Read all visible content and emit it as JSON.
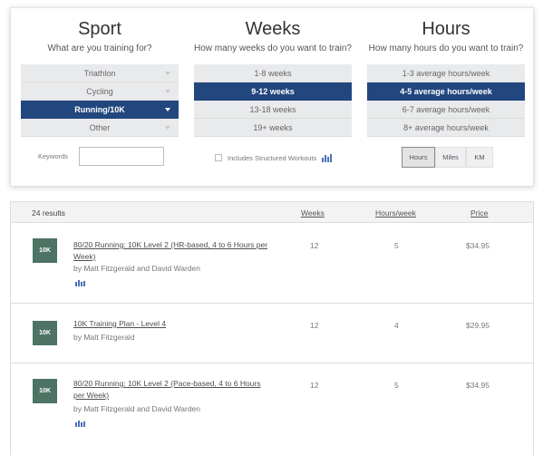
{
  "filters": {
    "sport": {
      "title": "Sport",
      "subtitle": "What are you training for?",
      "options": [
        {
          "label": "Triathlon",
          "selected": false
        },
        {
          "label": "Cycling",
          "selected": false
        },
        {
          "label": "Running/10K",
          "selected": true
        },
        {
          "label": "Other",
          "selected": false
        }
      ]
    },
    "weeks": {
      "title": "Weeks",
      "subtitle": "How many weeks do you want to train?",
      "options": [
        {
          "label": "1-8 weeks",
          "selected": false
        },
        {
          "label": "9-12 weeks",
          "selected": true
        },
        {
          "label": "13-18 weeks",
          "selected": false
        },
        {
          "label": "19+ weeks",
          "selected": false
        }
      ]
    },
    "hours": {
      "title": "Hours",
      "subtitle": "How many hours do you want to train?",
      "options": [
        {
          "label": "1-3 average hours/week",
          "selected": false
        },
        {
          "label": "4-5 average hours/week",
          "selected": true
        },
        {
          "label": "6-7 average hours/week",
          "selected": false
        },
        {
          "label": "8+ average hours/week",
          "selected": false
        }
      ]
    },
    "keywords": {
      "label": "Keywords",
      "value": "",
      "placeholder": ""
    },
    "structured": {
      "label": "Includes Structured Workouts",
      "checked": false,
      "icon": "bar-chart-icon"
    },
    "units": {
      "options": [
        "Hours",
        "Miles",
        "KM"
      ],
      "selected": "Hours"
    }
  },
  "results": {
    "count_label": "24 results",
    "columns": {
      "weeks": "Weeks",
      "hours": "Hours/week",
      "price": "Price"
    },
    "rows": [
      {
        "badge": "10K",
        "title": "80/20 Running: 10K Level 2 (HR-based, 4 to 6 Hours per Week)",
        "author": "by Matt Fitzgerald and David Warden",
        "weeks": "12",
        "hours": "5",
        "price": "$34.95",
        "structured_icon": true
      },
      {
        "badge": "10K",
        "title": "10K Training Plan - Level 4",
        "author": "by Matt Fitzgerald",
        "weeks": "12",
        "hours": "4",
        "price": "$29.95",
        "structured_icon": false
      },
      {
        "badge": "10K",
        "title": "80/20 Running: 10K Level 2 (Pace-based, 4 to 6 Hours per Week)",
        "author": "by Matt Fitzgerald and David Warden",
        "weeks": "12",
        "hours": "5",
        "price": "$34.95",
        "structured_icon": true
      }
    ]
  },
  "colors": {
    "selected_bg": "#22467e",
    "option_bg": "#e9eaec",
    "badge_bg": "#4c7364",
    "icon_blue": "#4a70b8"
  }
}
